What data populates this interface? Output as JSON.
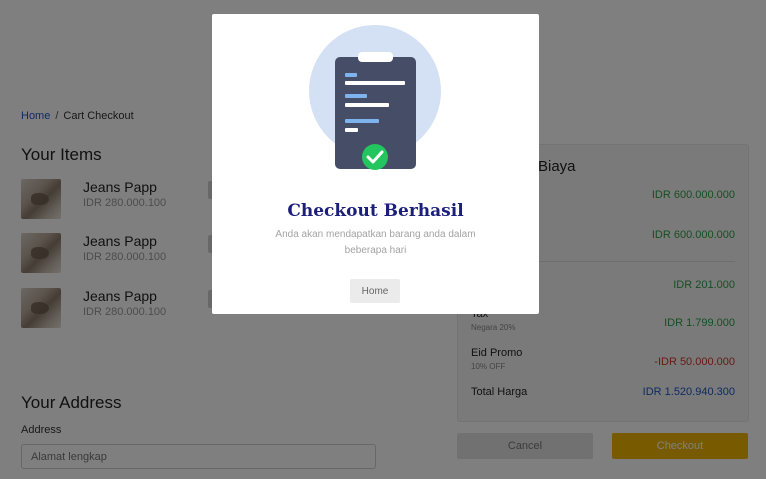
{
  "breadcrumb": {
    "home": "Home",
    "separator": "/",
    "current": "Cart Checkout"
  },
  "items_section": {
    "title": "Your Items",
    "items": [
      {
        "name": "Jeans Papp",
        "price": "IDR 280.000.100"
      },
      {
        "name": "Jeans Papp",
        "price": "IDR 280.000.100"
      },
      {
        "name": "Jeans Papp",
        "price": "IDR 280.000.100"
      }
    ]
  },
  "address_section": {
    "title": "Your Address",
    "label": "Address",
    "placeholder": "Alamat lengkap"
  },
  "summary": {
    "title": "Biaya",
    "rows": [
      {
        "label": "",
        "sub": "",
        "value": "IDR 600.000.000",
        "color": "#2f9e45"
      },
      {
        "label": "",
        "sub": "",
        "value": "IDR 600.000.000",
        "color": "#2f9e45"
      },
      {
        "label": "",
        "sub": "",
        "value": "IDR 201.000",
        "color": "#2f9e45"
      },
      {
        "label": "Tax",
        "sub": "Negara 20%",
        "value": "IDR 1.799.000",
        "color": "#2f9e45"
      },
      {
        "label": "Eid Promo",
        "sub": "10% OFF",
        "value": "-IDR 50.000.000",
        "color": "#d0342c"
      },
      {
        "label": "Total Harga",
        "sub": "",
        "value": "IDR 1.520.940.300",
        "color": "#1a56c8"
      }
    ]
  },
  "actions": {
    "cancel_label": "Cancel",
    "checkout_label": "Checkout"
  },
  "modal": {
    "title": "Checkout Berhasil",
    "description": "Anda akan mendapatkan barang anda dalam beberapa hari",
    "home_label": "Home",
    "illustration_icon": "clipboard-check-icon"
  },
  "colors": {
    "accent": "#f0b400",
    "title": "#1c1f7a",
    "link": "#1a56c8",
    "success": "#2f9e45",
    "danger": "#d0342c"
  }
}
